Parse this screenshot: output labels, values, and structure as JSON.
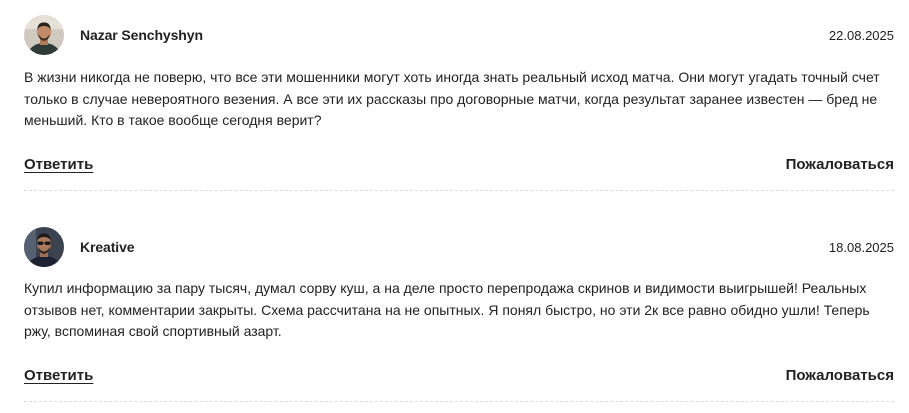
{
  "comments": [
    {
      "author": "Nazar Senchyshyn",
      "date": "22.08.2025",
      "text": "В жизни никогда не поверю, что все эти мошенники могут хоть иногда знать реальный исход матча. Они могут угадать точный счет только в случае невероятного везения. А все эти их рассказы про договорные матчи, когда результат заранее известен — бред не меньший. Кто в такое вообще сегодня верит?",
      "reply_label": "Ответить",
      "report_label": "Пожаловаться"
    },
    {
      "author": "Kreative",
      "date": "18.08.2025",
      "text": "Купил информацию за пару тысяч, думал сорву куш, а на деле просто перепродажа скринов и видимости выигрышей! Реальных отзывов нет, комментарии закрыты. Схема рассчитана на не опытных. Я понял быстро, но эти 2к все равно обидно ушли! Теперь ржу, вспоминая свой спортивный азарт.",
      "reply_label": "Ответить",
      "report_label": "Пожаловаться"
    }
  ],
  "colors": {
    "text": "#222222",
    "divider": "#dcdcdc",
    "background": "#ffffff"
  }
}
